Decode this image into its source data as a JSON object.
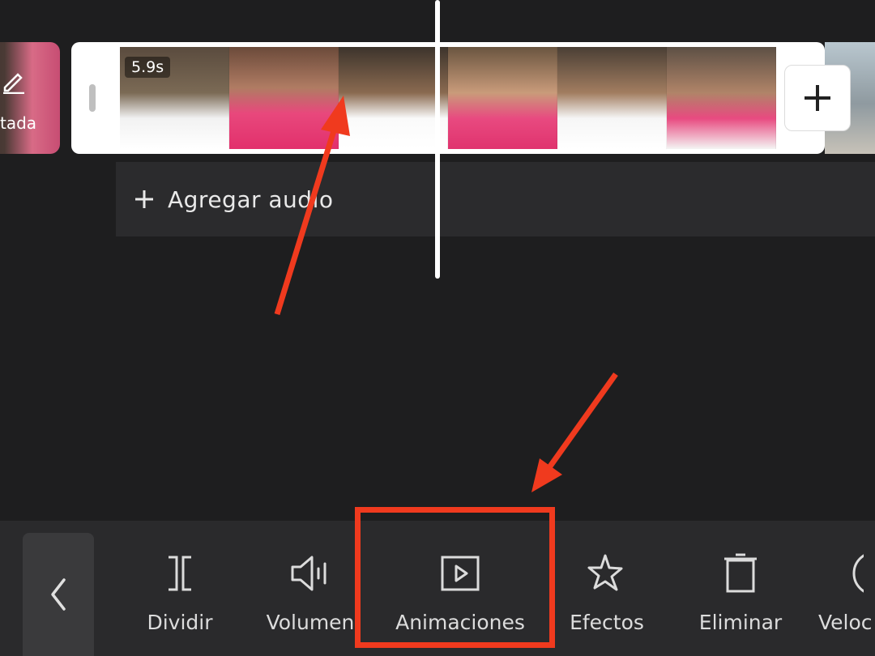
{
  "timeline": {
    "cover_label": "tada",
    "clip_duration": "5.9s",
    "add_clip_icon": "plus-icon",
    "audio_label": "Agregar audio"
  },
  "toolbar": {
    "back_icon": "chevron-left-icon",
    "tools": [
      {
        "label": "Dividir",
        "icon": "split-icon"
      },
      {
        "label": "Volumen",
        "icon": "volume-icon"
      },
      {
        "label": "Animaciones",
        "icon": "play-square-icon"
      },
      {
        "label": "Efectos",
        "icon": "star-effects-icon"
      },
      {
        "label": "Eliminar",
        "icon": "trash-icon"
      },
      {
        "label": "Veloc",
        "icon": "speed-icon"
      }
    ]
  },
  "colors": {
    "background": "#1e1e1f",
    "toolbar": "#2a2a2c",
    "highlight": "#f03a1e"
  }
}
